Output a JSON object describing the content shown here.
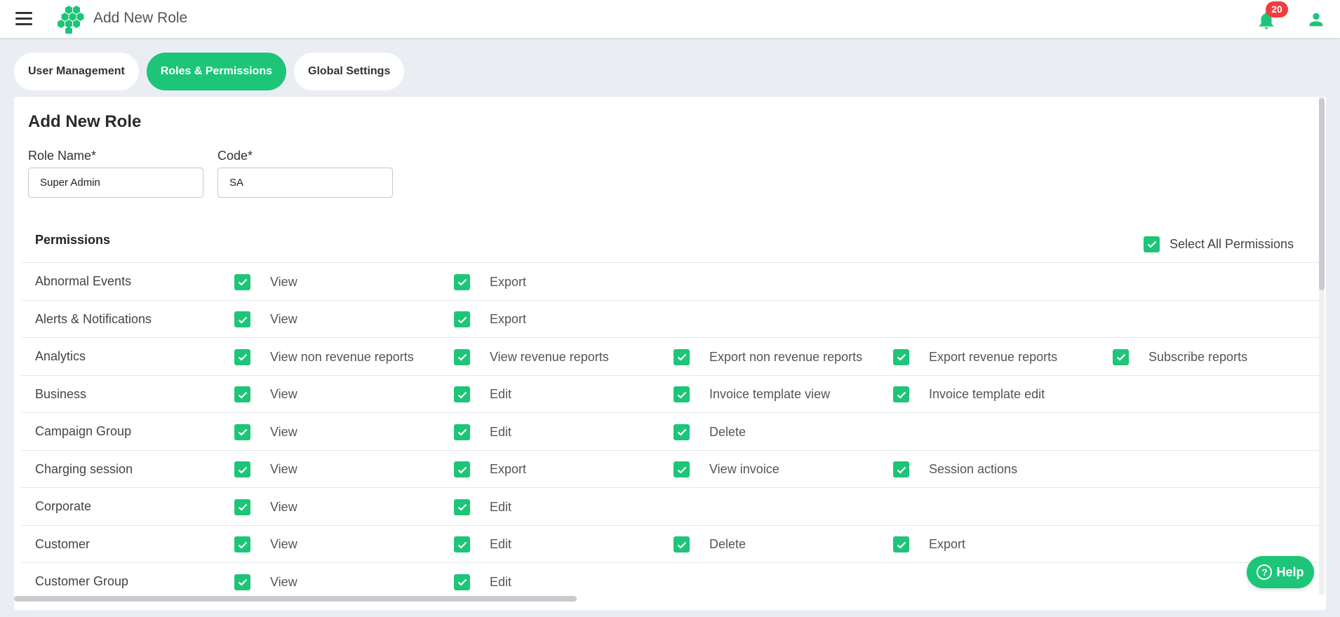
{
  "app": {
    "title": "Add New Role",
    "notification_count": "20"
  },
  "colors": {
    "accent": "#1dc578",
    "badge": "#f03c3c"
  },
  "tabs": [
    {
      "label": "User Management",
      "active": false
    },
    {
      "label": "Roles & Permissions",
      "active": true
    },
    {
      "label": "Global Settings",
      "active": false
    }
  ],
  "form": {
    "title": "Add New Role",
    "role_name_label": "Role Name*",
    "role_name_value": "Super Admin",
    "code_label": "Code*",
    "code_value": "SA"
  },
  "permissions": {
    "heading": "Permissions",
    "select_all_label": "Select All Permissions",
    "select_all_checked": true,
    "rows": [
      {
        "name": "Abnormal Events",
        "perms": [
          "View",
          "Export"
        ]
      },
      {
        "name": "Alerts & Notifications",
        "perms": [
          "View",
          "Export"
        ]
      },
      {
        "name": "Analytics",
        "perms": [
          "View non revenue reports",
          "View revenue reports",
          "Export non revenue reports",
          "Export revenue reports",
          "Subscribe reports"
        ]
      },
      {
        "name": "Business",
        "perms": [
          "View",
          "Edit",
          "Invoice template view",
          "Invoice template edit"
        ]
      },
      {
        "name": "Campaign Group",
        "perms": [
          "View",
          "Edit",
          "Delete"
        ]
      },
      {
        "name": "Charging session",
        "perms": [
          "View",
          "Export",
          "View invoice",
          "Session actions"
        ]
      },
      {
        "name": "Corporate",
        "perms": [
          "View",
          "Edit"
        ]
      },
      {
        "name": "Customer",
        "perms": [
          "View",
          "Edit",
          "Delete",
          "Export"
        ]
      },
      {
        "name": "Customer Group",
        "perms": [
          "View",
          "Edit"
        ]
      }
    ]
  },
  "help": {
    "label": "Help"
  },
  "icons": {
    "menu": "hamburger-menu-icon",
    "logo": "hexagon-cluster-logo",
    "bell": "bell-icon",
    "user": "user-icon",
    "check": "checkmark-icon",
    "help": "question-circle-icon"
  }
}
